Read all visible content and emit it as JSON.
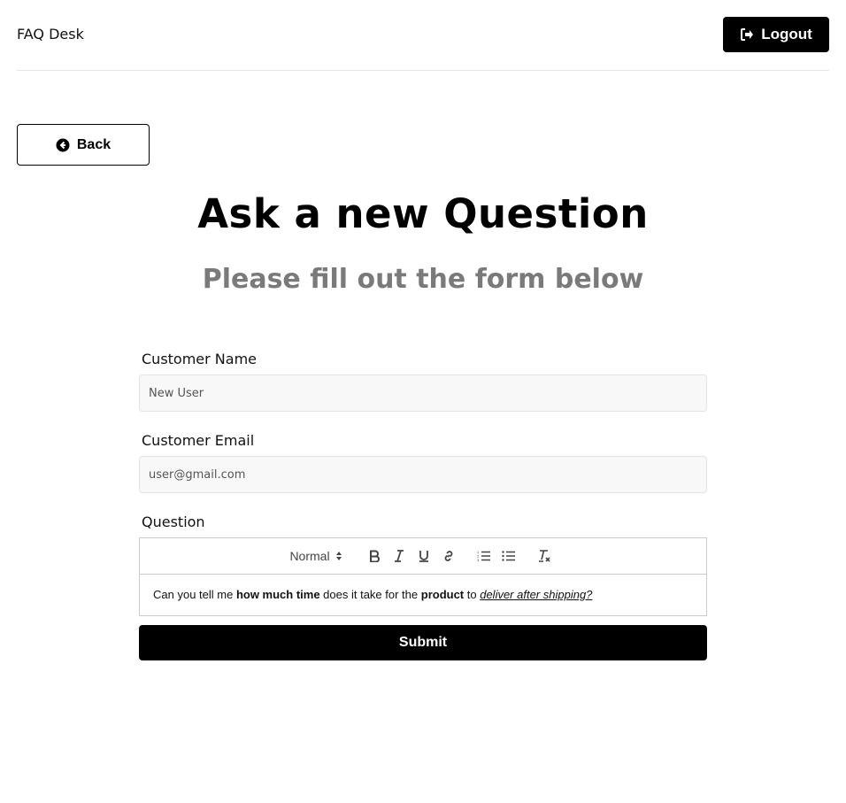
{
  "header": {
    "brand": "FAQ Desk",
    "logout_label": "Logout"
  },
  "nav": {
    "back_label": "Back"
  },
  "page": {
    "title": "Ask a new Question",
    "subtitle": "Please fill out the form below"
  },
  "form": {
    "name_label": "Customer Name",
    "name_placeholder": "New User",
    "email_label": "Customer Email",
    "email_placeholder": "user@gmail.com",
    "question_label": "Question",
    "editor": {
      "format_select": "Normal",
      "toolbar_buttons": [
        "bold-icon",
        "italic-icon",
        "underline-icon",
        "link-icon",
        "ordered-list-icon",
        "bullet-list-icon",
        "clear-format-icon"
      ],
      "content": {
        "t1": "Can you tell me ",
        "t2": "how much time",
        "t3": " does it take for the ",
        "t4": "product",
        "t5": " to ",
        "t6": "deliver after shipping?"
      }
    },
    "submit_label": "Submit"
  },
  "colors": {
    "primary": "#000000",
    "subtitle": "#7a7a7a",
    "input_bg": "#f8f8f8"
  }
}
